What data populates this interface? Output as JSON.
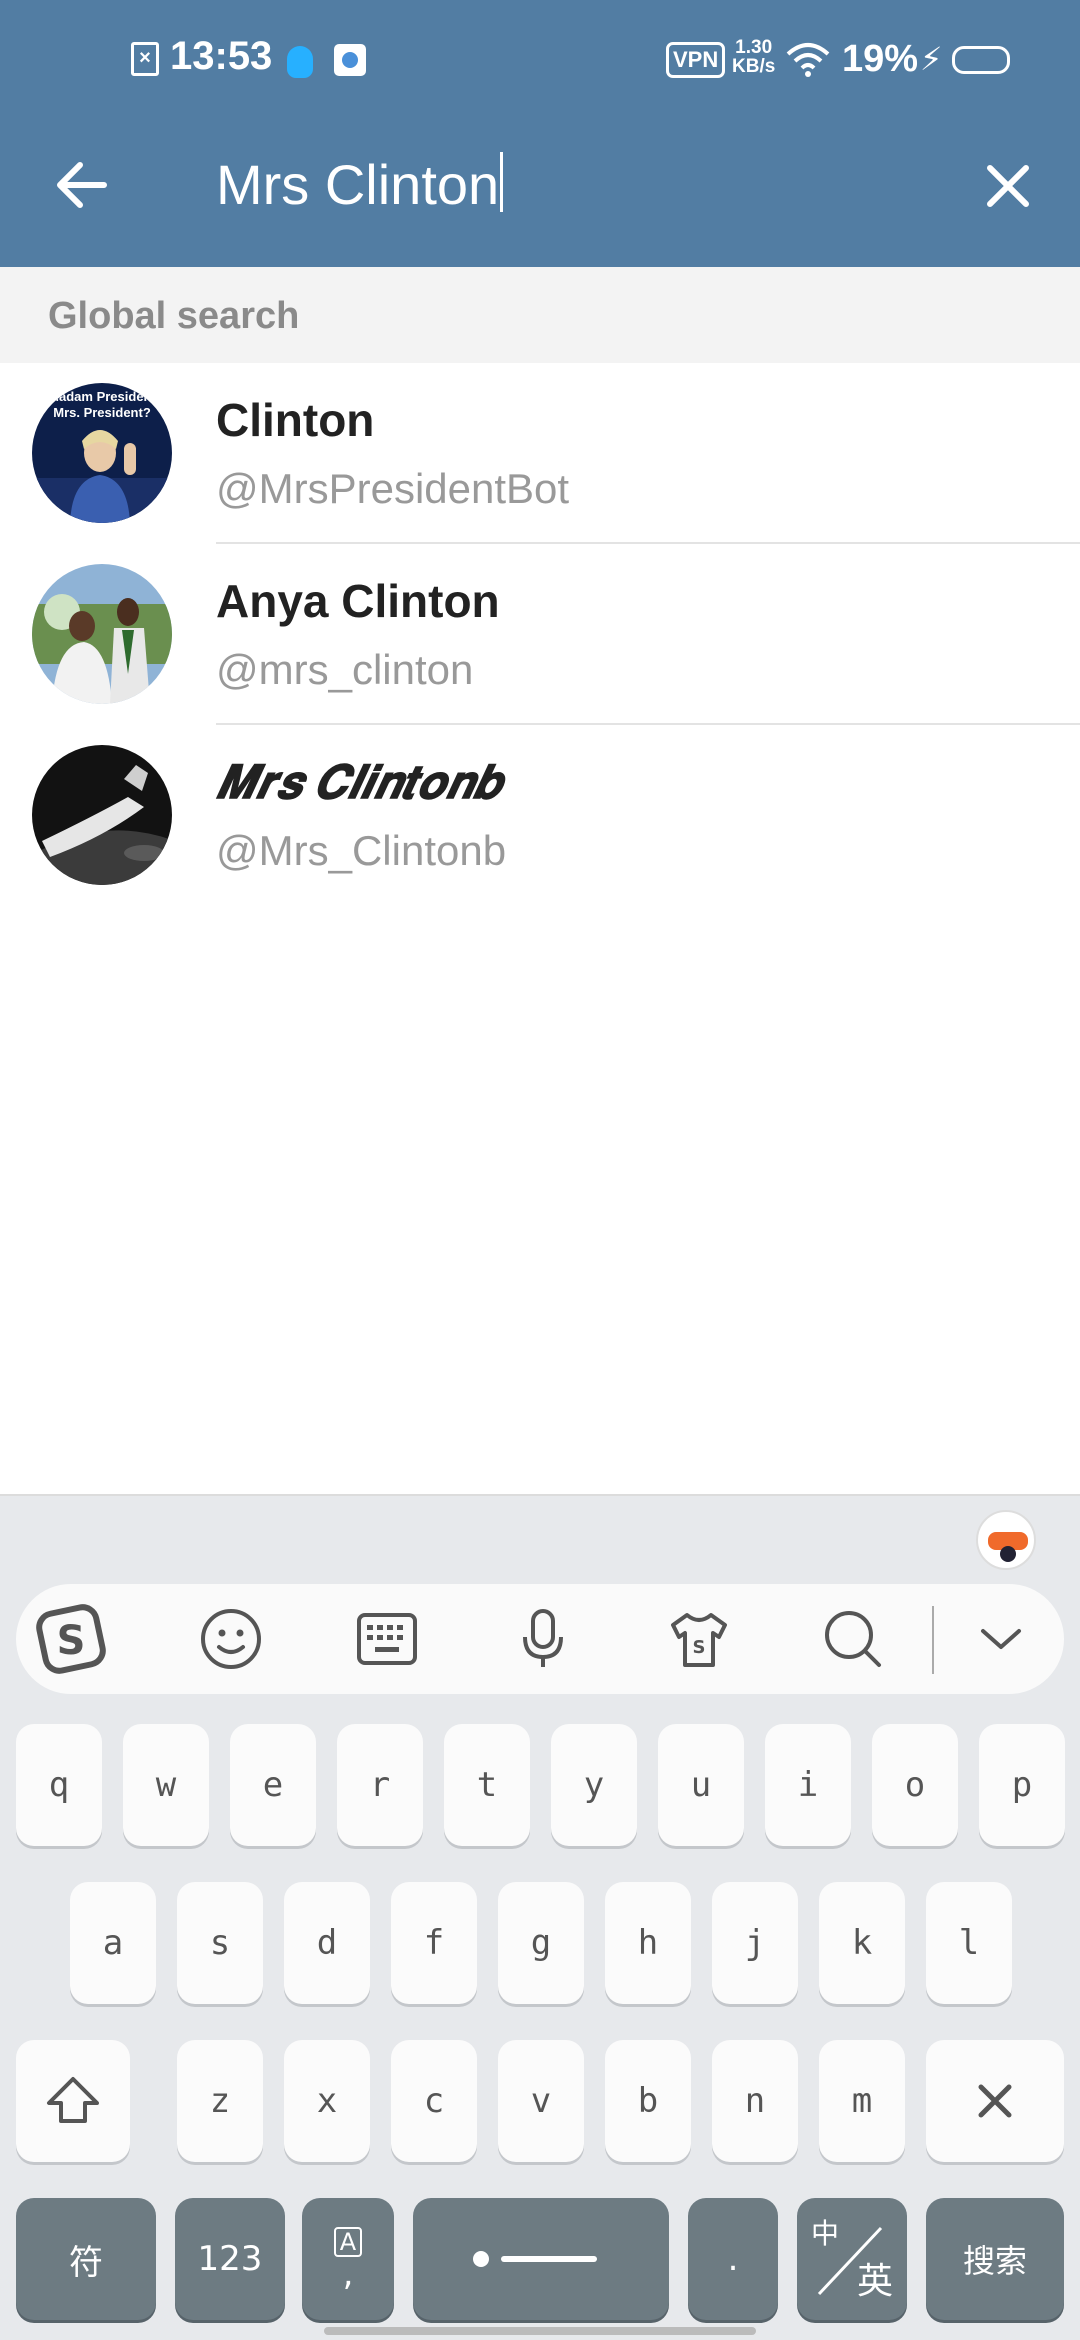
{
  "status_bar": {
    "time": "13:53",
    "vpn": "VPN",
    "speed_value": "1.30",
    "speed_unit": "KB/s",
    "battery": "19%"
  },
  "search": {
    "query": "Mrs Clinton"
  },
  "section": {
    "title": "Global search"
  },
  "results": [
    {
      "name": "Clinton",
      "handle": "@MrsPresidentBot"
    },
    {
      "name": "Anya Clinton",
      "handle": "@mrs_clinton"
    },
    {
      "name": "𝑴𝒓𝒔 𝑪𝒍𝒊𝒏𝒕𝒐𝒏𝒃",
      "handle": "@Mrs_Clintonb"
    }
  ],
  "avatar_texts": {
    "clinton_line1": "Madam President",
    "clinton_line2": "Mrs. President?"
  },
  "keyboard": {
    "row1": [
      "q",
      "w",
      "e",
      "r",
      "t",
      "y",
      "u",
      "i",
      "o",
      "p"
    ],
    "row2": [
      "a",
      "s",
      "d",
      "f",
      "g",
      "h",
      "j",
      "k",
      "l"
    ],
    "row3": [
      "z",
      "x",
      "c",
      "v",
      "b",
      "n",
      "m"
    ],
    "symbols": "符",
    "numbers": "123",
    "comma": ",",
    "period": ".",
    "lang_top": "中",
    "lang_bottom": "英",
    "search": "搜索"
  },
  "colors": {
    "header": "#527da3",
    "keyboard_bg": "#e7e9ec",
    "dark_key": "#6d7b82"
  }
}
